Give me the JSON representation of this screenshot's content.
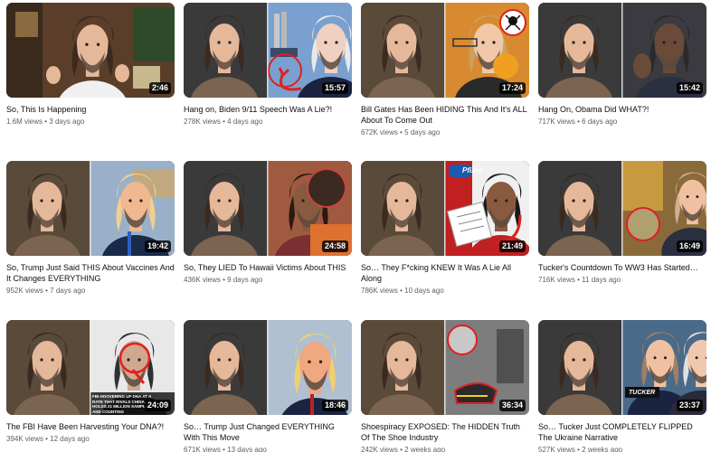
{
  "videos": [
    {
      "title": "So, This Is Happening",
      "views": "1.6M views",
      "age": "3 days ago",
      "duration": "2:46",
      "theme": "#7a5a3c"
    },
    {
      "title": "Hang on, Biden 9/11 Speech Was A Lie?!",
      "views": "278K views",
      "age": "4 days ago",
      "duration": "15:57",
      "theme": "#4a4a4a"
    },
    {
      "title": "Bill Gates Has Been HIDING This And It's ALL About To Come Out",
      "views": "672K views",
      "age": "5 days ago",
      "duration": "17:24",
      "theme": "#c86a1a"
    },
    {
      "title": "Hang On, Obama Did WHAT?!",
      "views": "717K views",
      "age": "6 days ago",
      "duration": "15:42",
      "theme": "#2f3b4c"
    },
    {
      "title": "So, Trump Just Said THIS About Vaccines And It Changes EVERYTHING",
      "views": "952K views",
      "age": "7 days ago",
      "duration": "19:42",
      "theme": "#3a5a82"
    },
    {
      "title": "So, They LIED To Hawaii Victims About THIS",
      "views": "436K views",
      "age": "9 days ago",
      "duration": "24:58",
      "theme": "#8a5a3a"
    },
    {
      "title": "So… They F*cking KNEW It Was A Lie All Along",
      "views": "786K views",
      "age": "10 days ago",
      "duration": "21:49",
      "theme": "#b02020"
    },
    {
      "title": "Tucker's Countdown To WW3 Has Started…",
      "views": "716K views",
      "age": "11 days ago",
      "duration": "16:49",
      "theme": "#6a5230"
    },
    {
      "title": "The FBI Have Been Harvesting Your DNA?!",
      "views": "394K views",
      "age": "12 days ago",
      "duration": "24:09",
      "theme": "#5a5a5a"
    },
    {
      "title": "So… Trump Just Changed EVERYTHING With This Move",
      "views": "671K views",
      "age": "13 days ago",
      "duration": "18:46",
      "theme": "#6a7a8a"
    },
    {
      "title": "Shoespiracy EXPOSED: The HIDDEN Truth Of The Shoe Industry",
      "views": "242K views",
      "age": "2 weeks ago",
      "duration": "36:34",
      "theme": "#8a8a8a"
    },
    {
      "title": "So… Tucker Just COMPLETELY FLIPPED The Ukraine Narrative",
      "views": "527K views",
      "age": "2 weeks ago",
      "duration": "23:37",
      "theme": "#3a4a5a"
    }
  ],
  "overlays": {
    "pfizer_badge": "Pfizer",
    "tucker_badge": "TUCKER",
    "fbi_caption": "FBI HOOVERING UP DNA AT A RATE THAT RIVALS CHINA, HOLDS 21 MILLION SAMPLES AND COUNTING"
  }
}
